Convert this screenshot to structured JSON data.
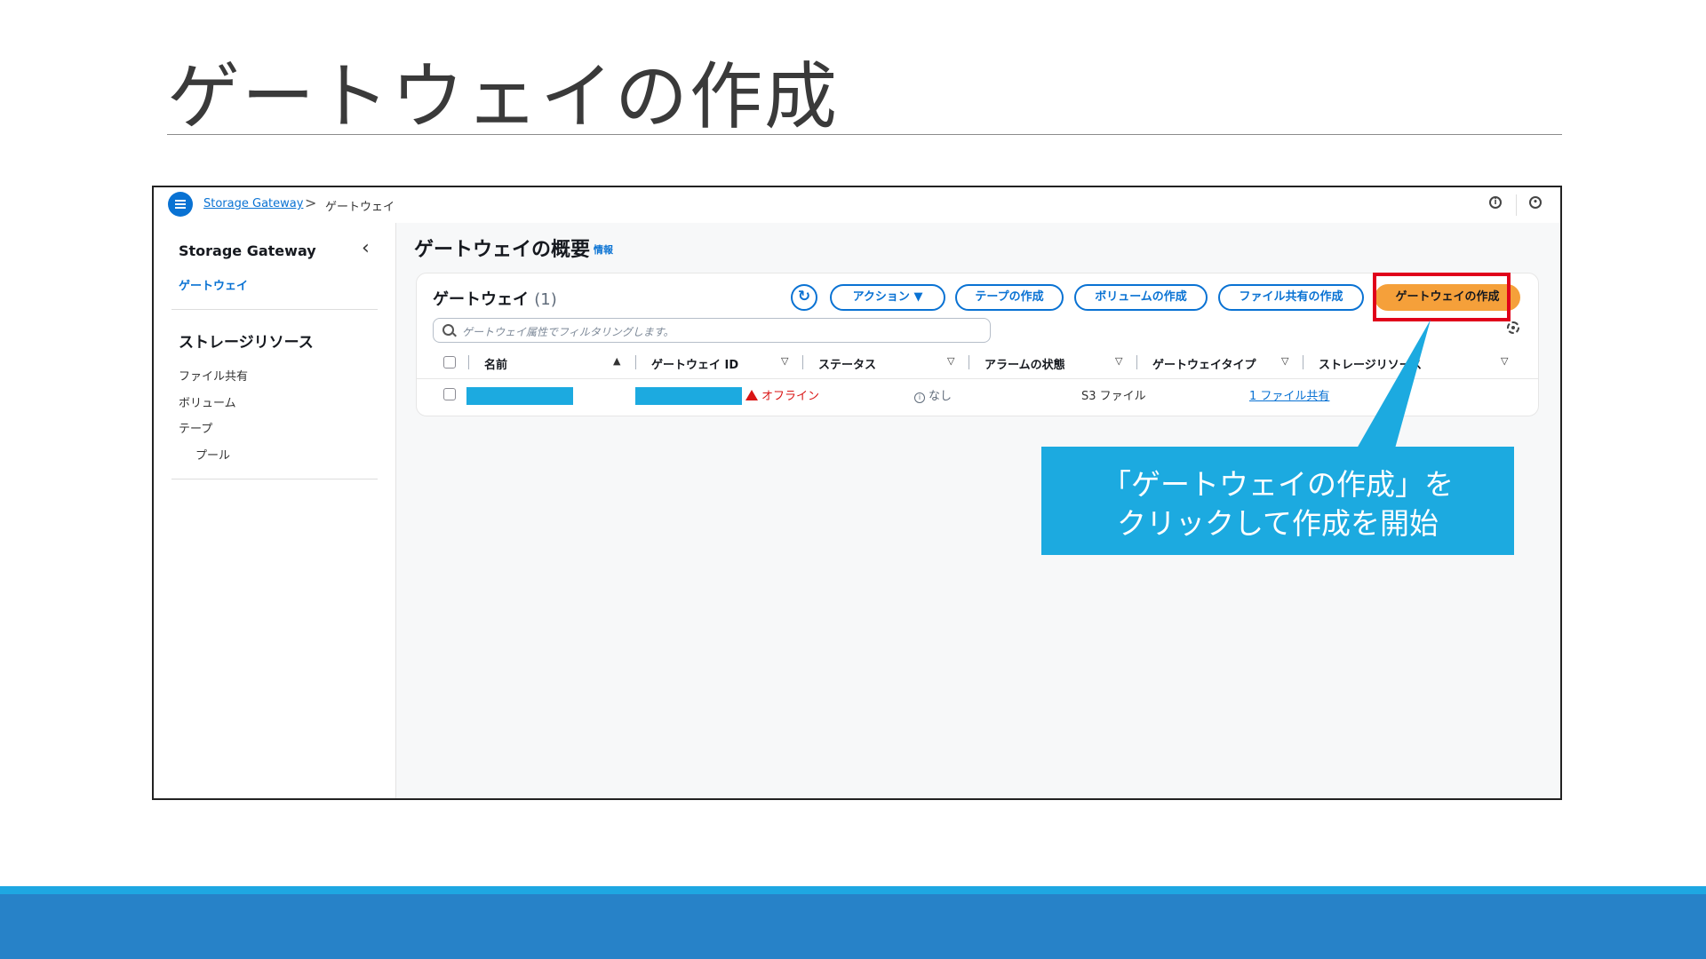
{
  "slide": {
    "title": "ゲートウェイの作成"
  },
  "topbar": {
    "breadcrumb_link": "Storage Gateway",
    "breadcrumb_separator": ">",
    "breadcrumb_current": "ゲートウェイ",
    "info_icon": "info-icon",
    "settings_icon": "notification-icon"
  },
  "sidebar": {
    "title": "Storage Gateway",
    "collapse_icon": "chevron-left-icon",
    "active_item": "ゲートウェイ",
    "section_title": "ストレージリソース",
    "items": [
      "ファイル共有",
      "ボリューム",
      "テープ"
    ],
    "sub_items": [
      "プール"
    ]
  },
  "main": {
    "heading": "ゲートウェイの概要",
    "info_link": "情報",
    "panel": {
      "title": "ゲートウェイ",
      "count": "(1)",
      "buttons": {
        "actions": "アクション ▼",
        "create_tape": "テープの作成",
        "create_volume": "ボリュームの作成",
        "create_file_share": "ファイル共有の作成",
        "create_gateway": "ゲートウェイの作成"
      },
      "search_placeholder": "ゲートウェイ属性でフィルタリングします。",
      "table": {
        "columns": [
          "名前",
          "ゲートウェイ ID",
          "ステータス",
          "アラームの状態",
          "ゲートウェイタイプ",
          "ストレージリソース"
        ],
        "sort_asc": "▲",
        "sort_desc": "▽",
        "row": {
          "status": "オフライン",
          "alarm": "なし",
          "type": "S3 ファイル",
          "storage": "1 ファイル共有"
        }
      }
    }
  },
  "callout": {
    "line1": "「ゲートウェイの作成」を",
    "line2": "クリックして作成を開始"
  },
  "colors": {
    "accent_blue": "#0972d3",
    "primary_orange": "#f5a03a",
    "callout_blue": "#1caae0",
    "highlight_red": "#e0001b",
    "band_blue": "#2782c8"
  }
}
